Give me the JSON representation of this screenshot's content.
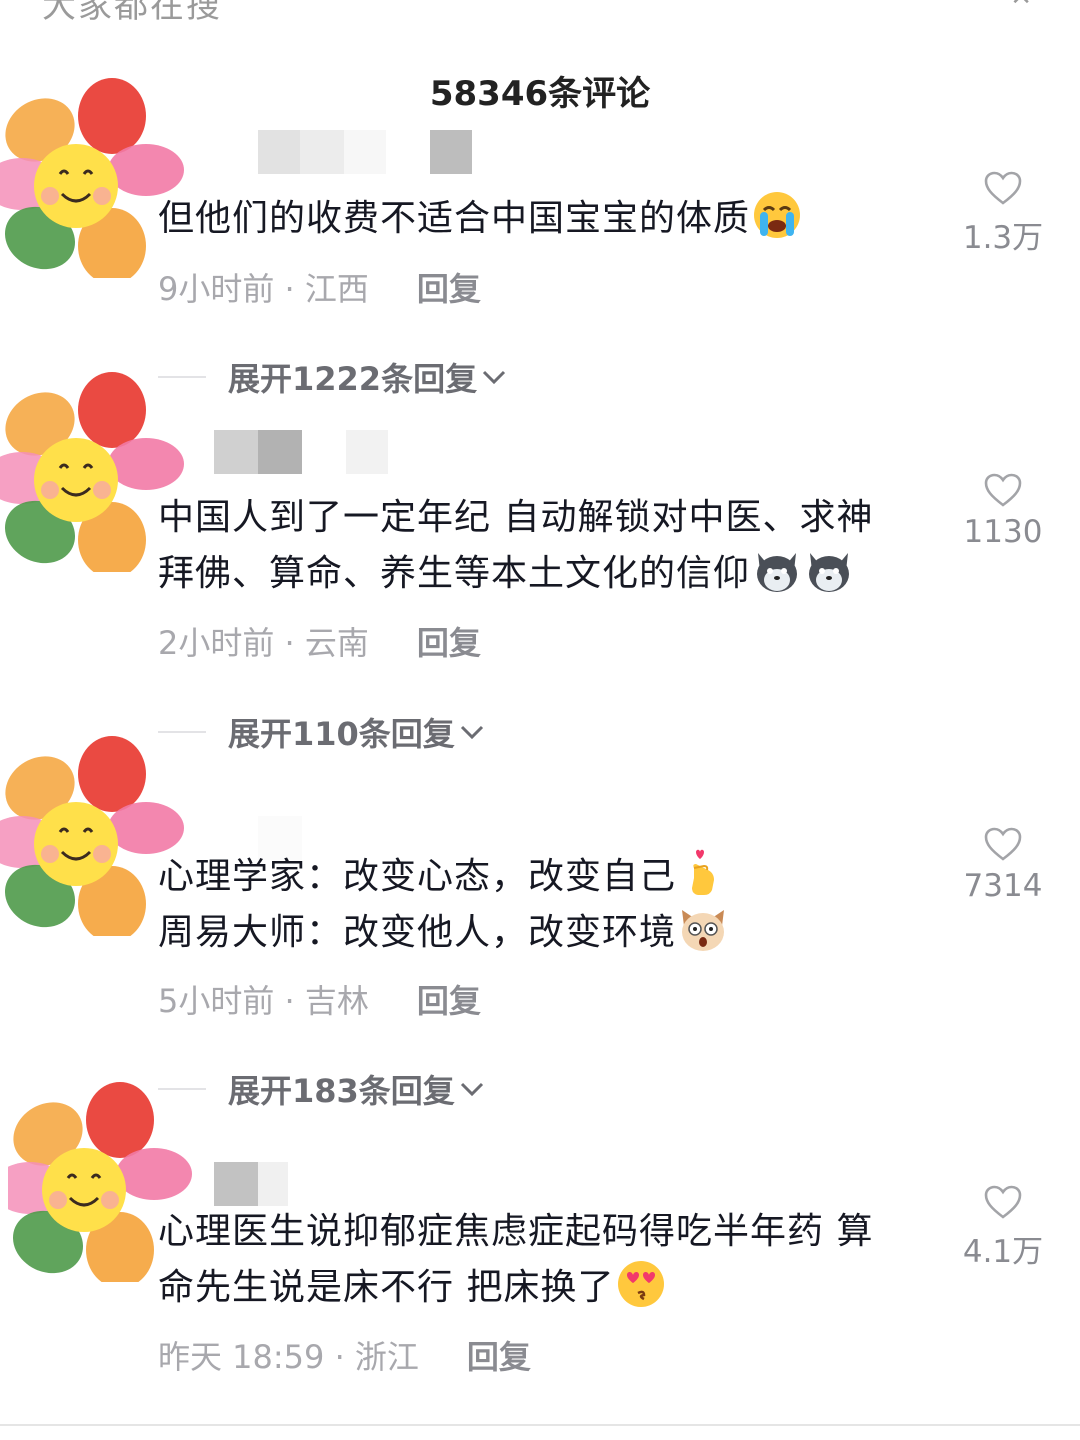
{
  "top_partial": {
    "text": "大家都在搜",
    "icon": "close-icon"
  },
  "header": {
    "count_label": "58346条评论"
  },
  "comments": [
    {
      "text": "但他们的收费不适合中国宝宝的体质",
      "emoji": "loudly-crying-face-emoji",
      "time": "9小时前 · 江西",
      "reply": "回复",
      "likes": "1.3万",
      "expand": "展开1222条回复"
    },
    {
      "line1": "中国人到了一定年纪 自动解锁对中医、求神",
      "line2": "拜佛、算命、养生等本土文化的信仰",
      "emoji": "husky-dog-emoji",
      "time": "2小时前 · 云南",
      "reply": "回复",
      "likes": "1130",
      "expand": "展开110条回复"
    },
    {
      "line1": "心理学家：改变心态，改变自己",
      "line2": "周易大师：改变他人，改变环境",
      "emoji1": "finger-heart-emoji",
      "emoji2": "surprised-cat-emoji",
      "time": "5小时前 · 吉林",
      "reply": "回复",
      "likes": "7314",
      "expand": "展开183条回复"
    },
    {
      "line1": "心理医生说抑郁症焦虑症起码得吃半年药 算",
      "line2": "命先生说是床不行 把床换了",
      "emoji": "heart-eyes-kiss-emoji",
      "time": "昨天 18:59 · 浙江",
      "reply": "回复",
      "likes": "4.1万"
    }
  ],
  "colors": {
    "text": "#161823",
    "meta": "#a8a8ad",
    "accent_emoji": "#ffcc33"
  }
}
